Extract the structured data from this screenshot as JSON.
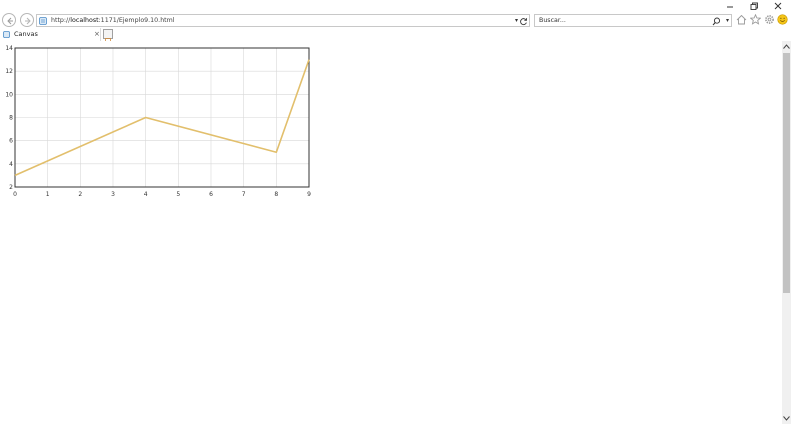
{
  "window": {
    "minimize_icon": "minimize-icon",
    "restore_icon": "restore-icon",
    "close_icon": "close-icon"
  },
  "toolbar": {
    "url_prefix": "http://",
    "url_host": "localhost",
    "url_rest": ":1171/Ejemplo9.10.html",
    "search_placeholder": "Buscar...",
    "icons": [
      "back-icon",
      "forward-icon",
      "refresh-icon",
      "search-icon",
      "home-icon",
      "favorites-star-icon",
      "settings-gear-icon",
      "smiley-feedback-icon"
    ]
  },
  "tabs": [
    {
      "label": "Canvas",
      "close": "×"
    }
  ],
  "colors": {
    "line": "#e2bf6c",
    "grid": "#d8d8d8",
    "frame": "#333333"
  },
  "chart_data": {
    "type": "line",
    "x": [
      0,
      4,
      8,
      9
    ],
    "y": [
      3,
      8,
      5,
      13
    ],
    "xlim": [
      0,
      9
    ],
    "ylim": [
      2,
      14
    ],
    "xticks": [
      "0",
      "1",
      "2",
      "3",
      "4",
      "5",
      "6",
      "7",
      "8",
      "9"
    ],
    "yticks": [
      "2",
      "4",
      "6",
      "8",
      "10",
      "12",
      "14"
    ],
    "grid": true,
    "title": "",
    "xlabel": "",
    "ylabel": ""
  }
}
